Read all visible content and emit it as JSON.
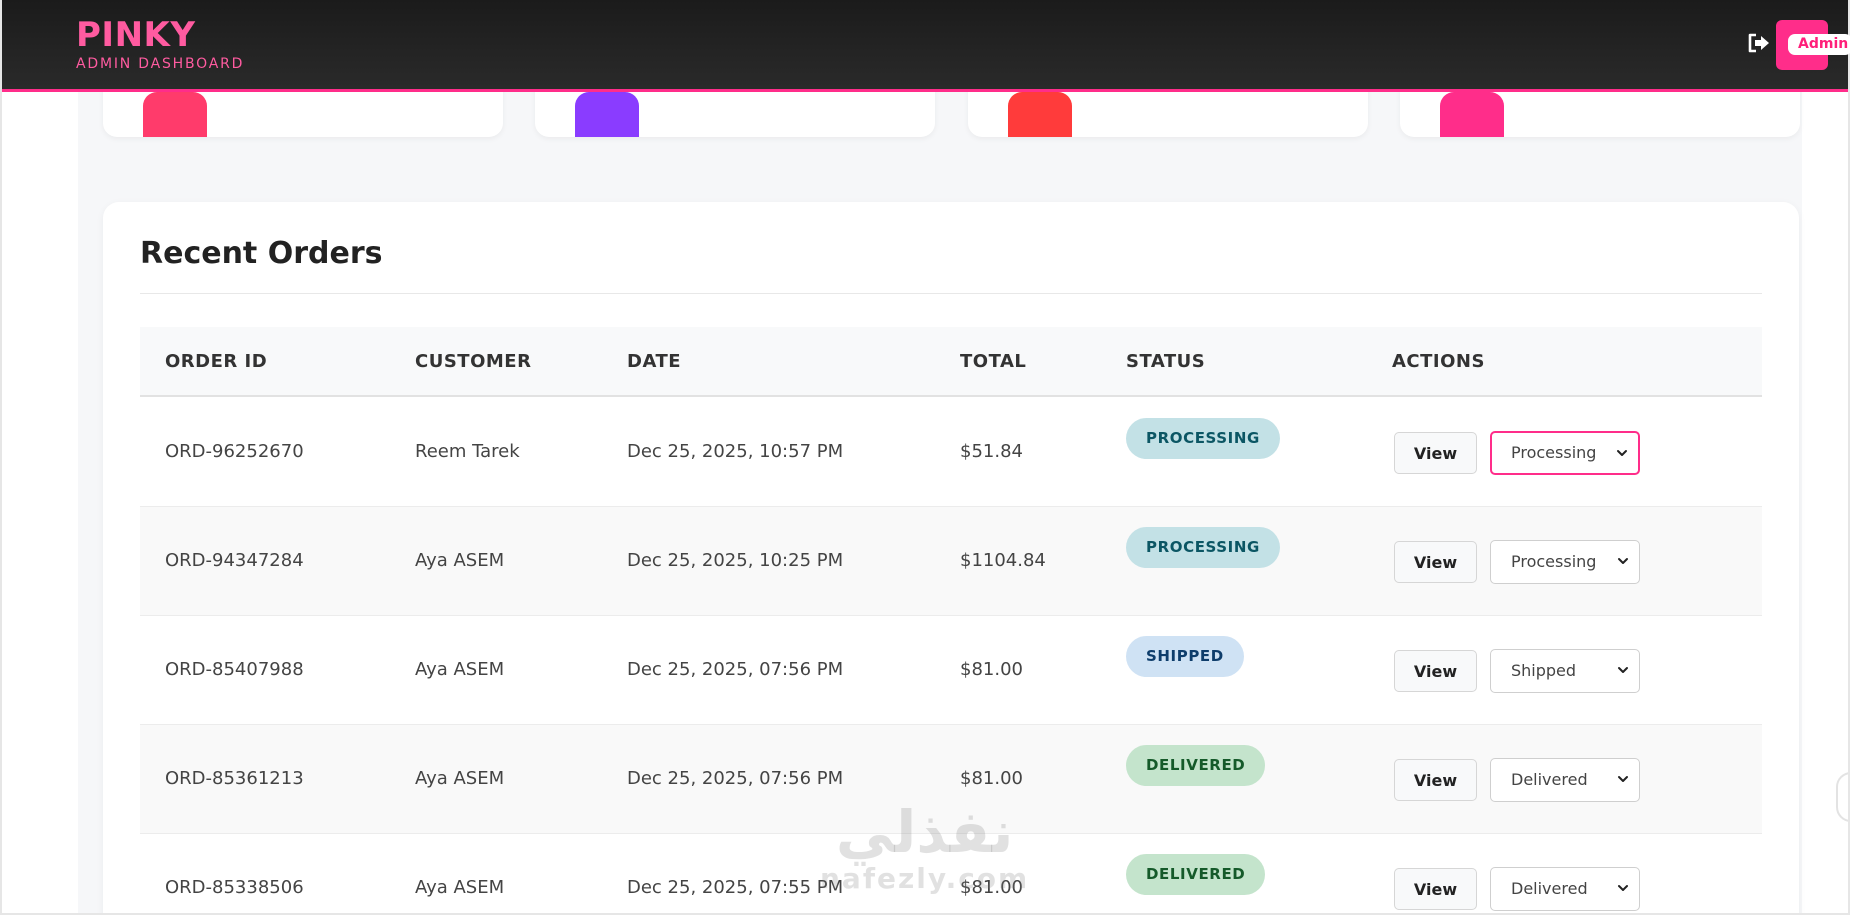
{
  "header": {
    "brand": "PINKY",
    "subtitle": "ADMIN DASHBOARD",
    "logout_icon": "logout-icon",
    "user_label": "Admin",
    "accent_color": "#ff2d8a"
  },
  "stat_cards": [
    {
      "accent": "#ff3b6b"
    },
    {
      "accent": "#8a3cff"
    },
    {
      "accent": "#ff3b3b"
    },
    {
      "accent": "#ff2d8a"
    }
  ],
  "orders": {
    "title": "Recent Orders",
    "columns": {
      "order_id": "ORDER ID",
      "customer": "CUSTOMER",
      "date": "DATE",
      "total": "TOTAL",
      "status": "STATUS",
      "actions": "ACTIONS"
    },
    "view_label": "View",
    "rows": [
      {
        "id": "ORD-96252670",
        "customer": "Reem Tarek",
        "date": "Dec 25, 2025, 10:57 PM",
        "total": "$51.84",
        "status": "PROCESSING",
        "select": "Processing"
      },
      {
        "id": "ORD-94347284",
        "customer": "Aya ASEM",
        "date": "Dec 25, 2025, 10:25 PM",
        "total": "$1104.84",
        "status": "PROCESSING",
        "select": "Processing"
      },
      {
        "id": "ORD-85407988",
        "customer": "Aya ASEM",
        "date": "Dec 25, 2025, 07:56 PM",
        "total": "$81.00",
        "status": "SHIPPED",
        "select": "Shipped"
      },
      {
        "id": "ORD-85361213",
        "customer": "Aya ASEM",
        "date": "Dec 25, 2025, 07:56 PM",
        "total": "$81.00",
        "status": "DELIVERED",
        "select": "Delivered"
      },
      {
        "id": "ORD-85338506",
        "customer": "Aya ASEM",
        "date": "Dec 25, 2025, 07:55 PM",
        "total": "$81.00",
        "status": "DELIVERED",
        "select": "Delivered"
      }
    ],
    "status_colors": {
      "PROCESSING": {
        "bg": "#c3e1e6",
        "fg": "#0b5664"
      },
      "SHIPPED": {
        "bg": "#cfe2f4",
        "fg": "#0e3d6b"
      },
      "DELIVERED": {
        "bg": "#c4e4cc",
        "fg": "#155a2a"
      }
    }
  },
  "watermark": {
    "arabic": "نفذلي",
    "latin": "nafezly.com"
  }
}
